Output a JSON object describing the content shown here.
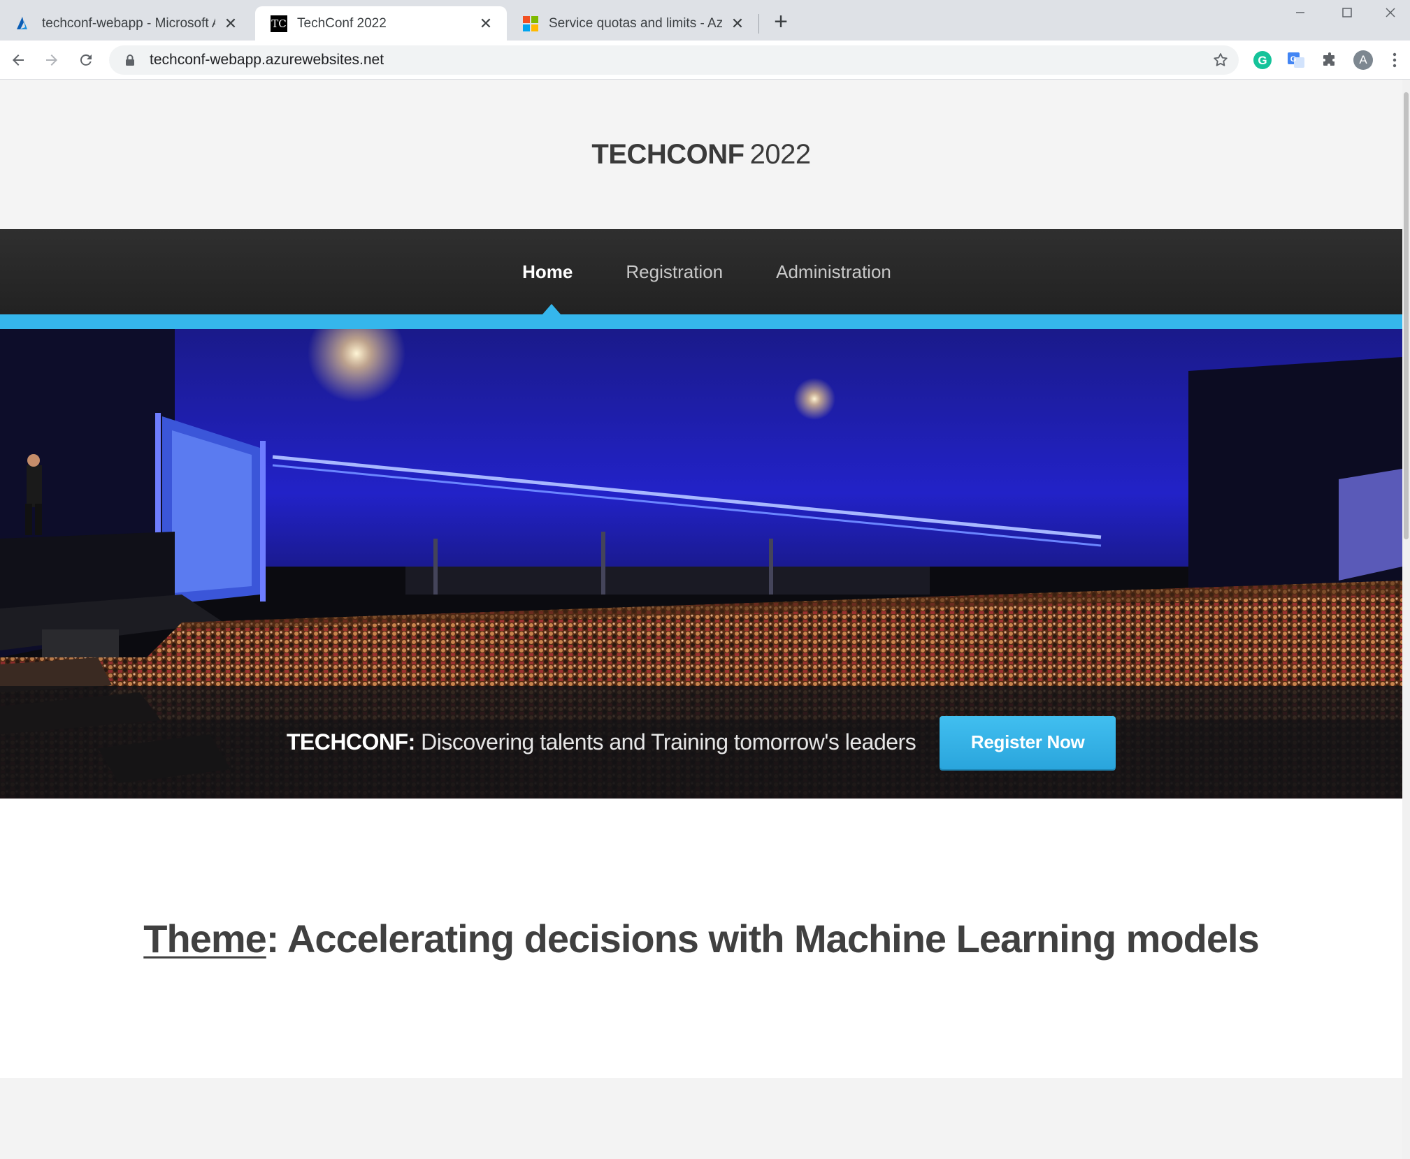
{
  "browser": {
    "tabs": [
      {
        "title": "techconf-webapp - Microsoft Azure",
        "icon": "azure-icon",
        "active": false
      },
      {
        "title": "TechConf 2022",
        "icon": "tc-icon",
        "active": true
      },
      {
        "title": "Service quotas and limits - Azure",
        "icon": "microsoft-icon",
        "active": false
      }
    ],
    "tc_favicon_text": "TC",
    "url": "techconf-webapp.azurewebsites.net",
    "profile_initial": "A"
  },
  "site": {
    "brand_bold": "TECHCONF",
    "brand_light": "2022",
    "nav": [
      {
        "label": "Home",
        "active": true
      },
      {
        "label": "Registration",
        "active": false
      },
      {
        "label": "Administration",
        "active": false
      }
    ],
    "accent_color": "#35b6ec",
    "hero": {
      "tagline_lead": "TECHCONF:",
      "tagline_text": "Discovering talents and Training tomorrow's leaders",
      "cta_label": "Register Now"
    },
    "theme": {
      "label": "Theme",
      "separator": ":",
      "text": "Accelerating decisions with Machine Learning models"
    }
  }
}
